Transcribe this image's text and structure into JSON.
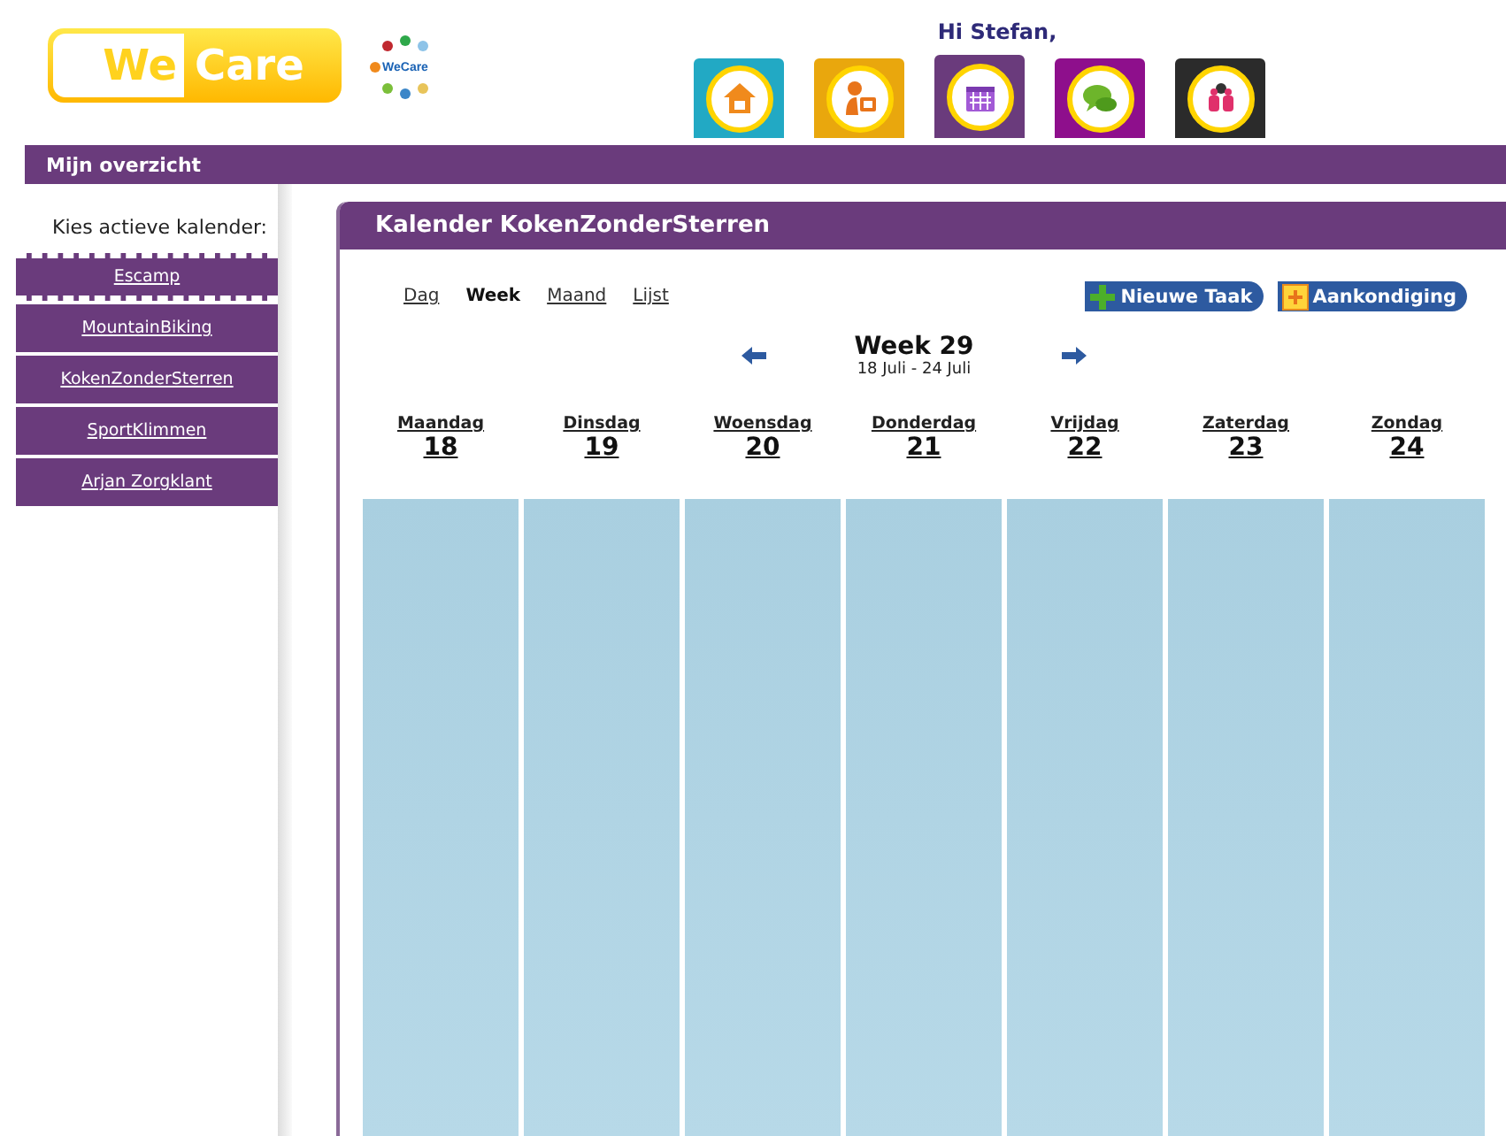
{
  "header": {
    "logo": {
      "first": "We",
      "second": "Care"
    },
    "small_logo": "WeCare",
    "greeting": "Hi Stefan,"
  },
  "tabs": [
    {
      "kind": "home",
      "color": "#22a9c4",
      "selected": false
    },
    {
      "kind": "profile",
      "color": "#e9a70d",
      "selected": false
    },
    {
      "kind": "calendar",
      "color": "#6a3b7c",
      "selected": true
    },
    {
      "kind": "chat",
      "color": "#8e0f8c",
      "selected": false
    },
    {
      "kind": "people",
      "color": "#2b2b2b",
      "selected": false
    }
  ],
  "nav_bar": {
    "title": "Mijn overzicht"
  },
  "sidebar": {
    "label": "Kies actieve kalender:",
    "items": [
      {
        "label": "Escamp",
        "selected": true
      },
      {
        "label": "MountainBiking",
        "selected": false
      },
      {
        "label": "KokenZonderSterren",
        "selected": false
      },
      {
        "label": "SportKlimmen",
        "selected": false
      },
      {
        "label": "Arjan Zorgklant",
        "selected": false
      }
    ]
  },
  "panel": {
    "title": "Kalender KokenZonderSterren",
    "views": [
      {
        "label": "Dag",
        "selected": false
      },
      {
        "label": "Week",
        "selected": true
      },
      {
        "label": "Maand",
        "selected": false
      },
      {
        "label": "Lijst",
        "selected": false
      }
    ],
    "actions": [
      {
        "kind": "task",
        "label": "Nieuwe Taak"
      },
      {
        "kind": "announcement",
        "label": "Aankondiging"
      }
    ],
    "week": {
      "title": "Week 29",
      "range": "18 Juli - 24 Juli"
    },
    "days": [
      {
        "name": "Maandag",
        "date": "18"
      },
      {
        "name": "Dinsdag",
        "date": "19"
      },
      {
        "name": "Woensdag",
        "date": "20"
      },
      {
        "name": "Donderdag",
        "date": "21"
      },
      {
        "name": "Vrijdag",
        "date": "22"
      },
      {
        "name": "Zaterdag",
        "date": "23"
      },
      {
        "name": "Zondag",
        "date": "24"
      }
    ]
  }
}
